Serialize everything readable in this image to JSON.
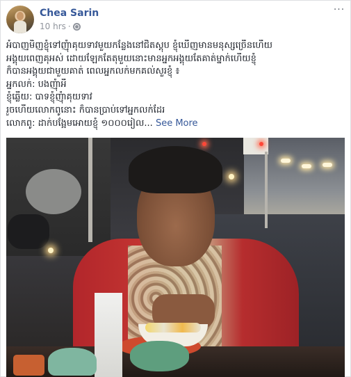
{
  "post": {
    "author": "Chea Sarin",
    "timestamp": "10 hrs",
    "separator": "·",
    "privacy_icon": "globe-icon",
    "more_options": "···",
    "text_lines": [
      "អំបាញមិញខ្ញុំទៅញុំាគុយទាវមួយកន្លែងនៅជិតស្តុប ខ្ញុំឃើញមានមនុស្សច្រើនហើយ",
      "អង្គុយពេញគុអស់ ដោយឡែកតែតុមួយនោះមានអ្នកអង្គុយតែគាត់ម្នាក់ហើយខ្ញុំ",
      "ក៏បានអង្គុយជាមួយគាត់ ពេលអ្នកលក់មកគល់សួរខ្ញុំ ៖",
      "អ្នកលក់: បងញុំាអី",
      "ខ្ញុំឆ្លើយ: បាទខ្ញុំញុំាគុយទាវ",
      "រួចហើយលោកពូនោះ ក៏បានប្រាប់ទៅអ្នកលក់ដែរ"
    ],
    "last_line": "លោកពូ: ដាក់បង្អែមអោយខ្ញុំ ១០០០រៀល",
    "ellipsis": "...",
    "see_more": "See More",
    "photo_alt": "Man eating at a street food table at night"
  },
  "colors": {
    "author_link": "#365899",
    "meta_gray": "#90949c",
    "body_text": "#1d2129"
  }
}
